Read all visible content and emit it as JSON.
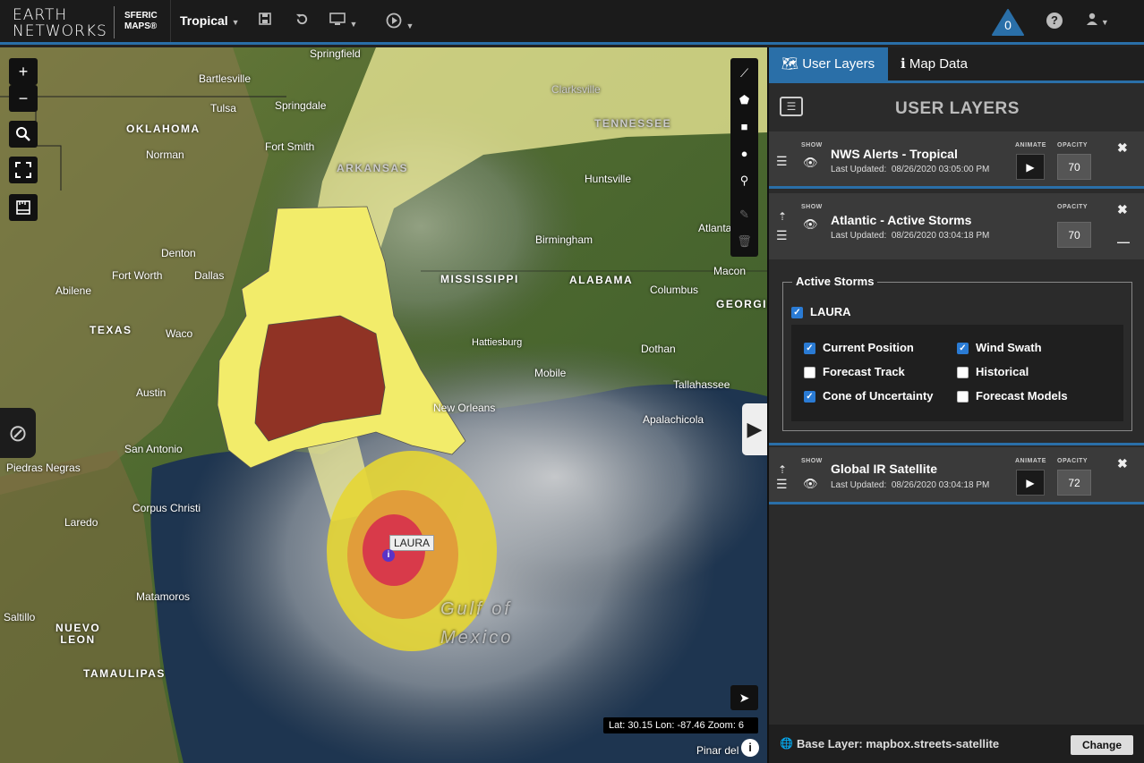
{
  "header": {
    "logo_line1": "EARTH",
    "logo_line2": "NETWORKS",
    "product_line1": "SFERIC",
    "product_line2": "MAPS®",
    "region_select": "Tropical",
    "alert_count": "0",
    "icons": [
      "save-icon",
      "undo-icon",
      "monitor-icon",
      "play-circle-icon",
      "alert-icon",
      "help-icon",
      "user-icon"
    ]
  },
  "map": {
    "labels": {
      "springfield": "Springfield",
      "bartlesville": "Bartlesville",
      "tulsa": "Tulsa",
      "springdale": "Springdale",
      "oklahoma": "OKLAHOMA",
      "norman": "Norman",
      "fortsmith": "Fort Smith",
      "arkansas": "ARKANSAS",
      "clarksville": "Clarksville",
      "tennessee": "TENNESSEE",
      "huntsville": "Huntsville",
      "denton": "Denton",
      "fortworth": "Fort Worth",
      "dallas": "Dallas",
      "abilene": "Abilene",
      "texas": "TEXAS",
      "waco": "Waco",
      "austin": "Austin",
      "sanantonio": "San Antonio",
      "piedras": "Piedras Negras",
      "corpus": "Corpus Christi",
      "laredo": "Laredo",
      "matamoros": "Matamoros",
      "saltillo": "Saltillo",
      "nuevoleon": "NUEVO LEON",
      "tamaulipas": "TAMAULIPAS",
      "mississippi": "MISSISSIPPI",
      "alabama": "ALABAMA",
      "birmingham": "Birmingham",
      "atlanta": "Atlanta",
      "macon": "Macon",
      "columbus": "Columbus",
      "georgia": "GEORGIA",
      "hattiesburg": "Hattiesburg",
      "dothan": "Dothan",
      "mobile": "Mobile",
      "tallahassee": "Tallahassee",
      "neworleans": "New Orleans",
      "apalachicola": "Apalachicola",
      "gulf1": "Gulf of",
      "gulf2": "Mexico",
      "pinar": "Pinar del"
    },
    "storm_label": "LAURA",
    "coords": "Lat: 30.15 Lon: -87.46 Zoom: 6",
    "zoom_in": "+",
    "zoom_out": "−"
  },
  "panel": {
    "tabs": {
      "user_layers": "User Layers",
      "map_data": "Map Data"
    },
    "title": "USER LAYERS",
    "show_label": "SHOW",
    "animate_label": "ANIMATE",
    "opacity_label": "OPACITY",
    "updated_prefix": "Last Updated:",
    "layers": [
      {
        "name": "NWS Alerts - Tropical",
        "updated": "08/26/2020 03:05:00 PM",
        "opacity": "70"
      },
      {
        "name": "Atlantic - Active Storms",
        "updated": "08/26/2020 03:04:18 PM",
        "opacity": "70"
      },
      {
        "name": "Global IR Satellite",
        "updated": "08/26/2020 03:04:18 PM",
        "opacity": "72"
      }
    ],
    "active_storms": {
      "legend": "Active Storms",
      "storm": "LAURA",
      "options": [
        {
          "label": "Current Position",
          "checked": true
        },
        {
          "label": "Wind Swath",
          "checked": true
        },
        {
          "label": "Forecast Track",
          "checked": false
        },
        {
          "label": "Historical",
          "checked": false
        },
        {
          "label": "Cone of Uncertainty",
          "checked": true
        },
        {
          "label": "Forecast Models",
          "checked": false
        }
      ]
    },
    "base_layer": "Base Layer: mapbox.streets-satellite",
    "change_button": "Change"
  }
}
